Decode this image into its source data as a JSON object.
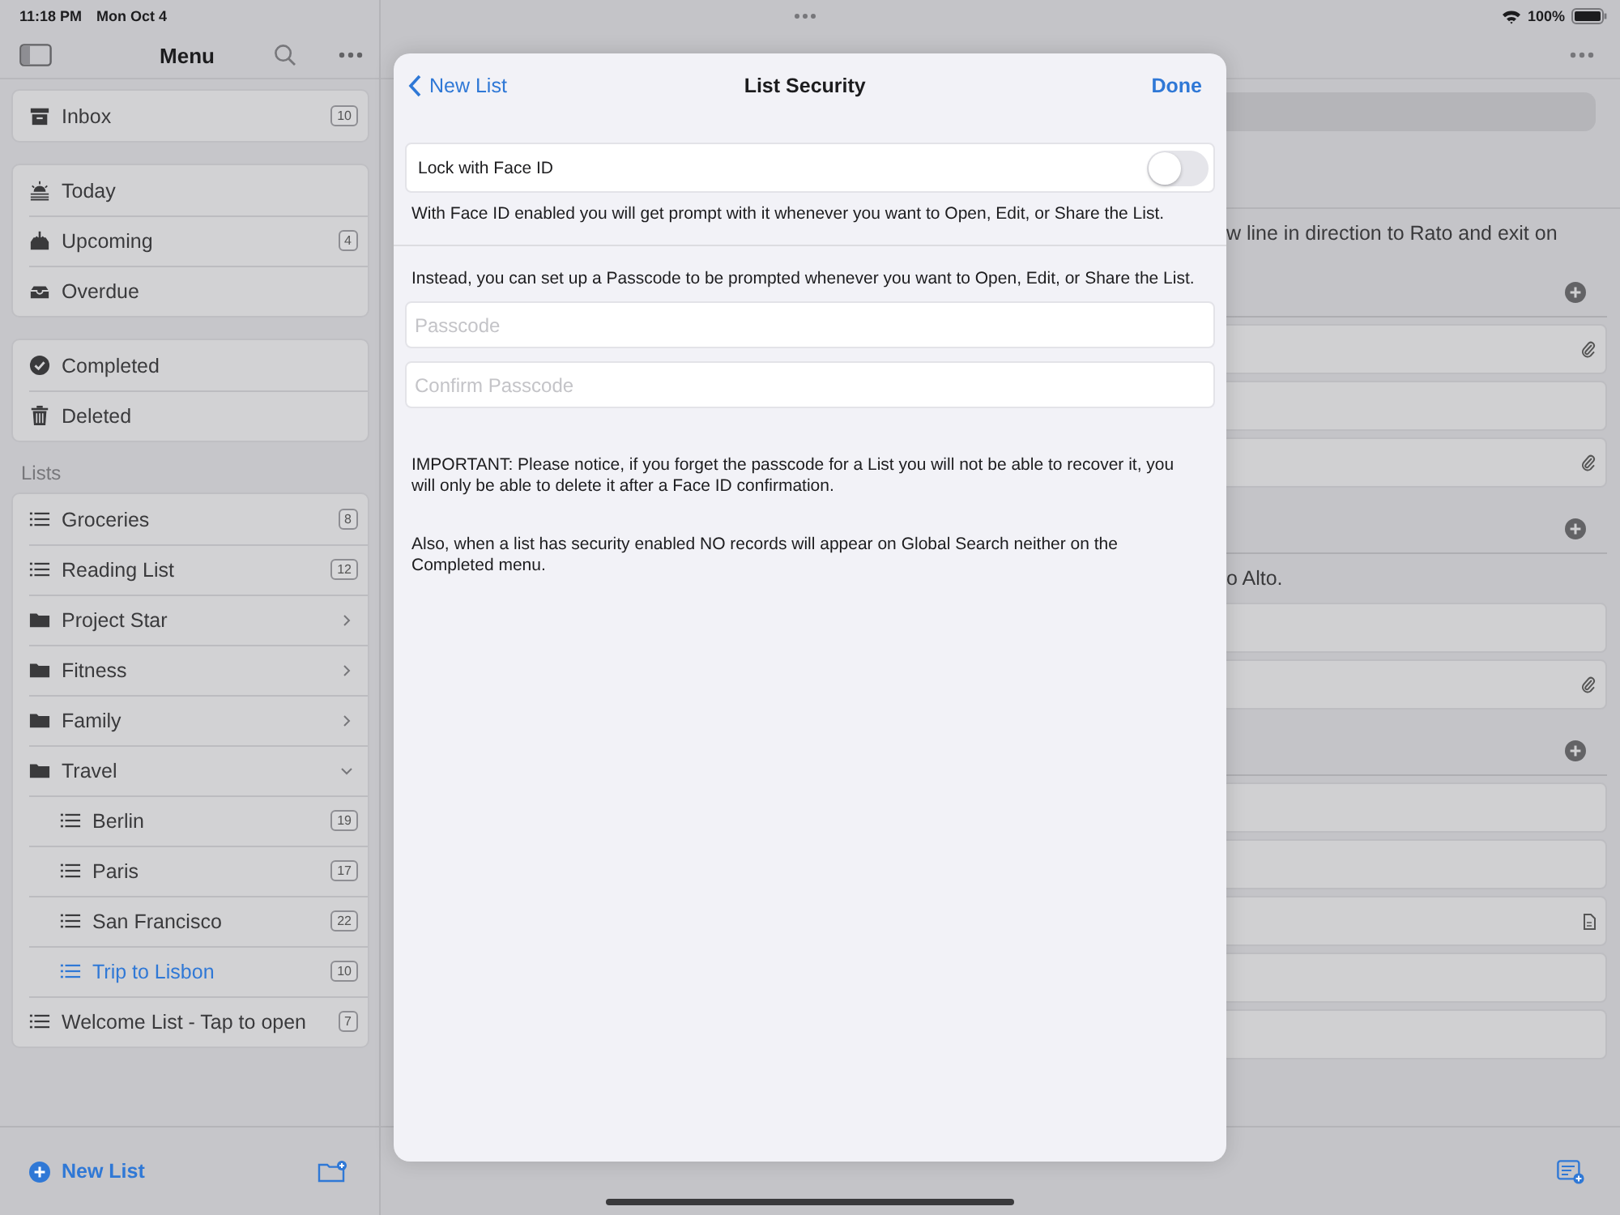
{
  "status_bar": {
    "time": "11:18 PM",
    "date": "Mon Oct 4",
    "battery": "100%"
  },
  "sidebar": {
    "title": "Menu",
    "groups": [
      [
        {
          "label": "Inbox",
          "kind": "inbox",
          "badge": "10"
        }
      ],
      [
        {
          "label": "Today",
          "kind": "today"
        },
        {
          "label": "Upcoming",
          "kind": "upcoming",
          "badge": "4"
        },
        {
          "label": "Overdue",
          "kind": "overdue"
        }
      ],
      [
        {
          "label": "Completed",
          "kind": "completed"
        },
        {
          "label": "Deleted",
          "kind": "deleted"
        }
      ]
    ],
    "lists_heading": "Lists",
    "lists": [
      {
        "label": "Groceries",
        "kind": "list",
        "badge": "8",
        "selected": false
      },
      {
        "label": "Reading List",
        "kind": "list",
        "badge": "12",
        "selected": false
      },
      {
        "label": "Project Star",
        "kind": "folder",
        "expanded": false,
        "selected": false
      },
      {
        "label": "Fitness",
        "kind": "folder",
        "expanded": false,
        "selected": false
      },
      {
        "label": "Family",
        "kind": "folder",
        "expanded": false,
        "selected": false
      },
      {
        "label": "Travel",
        "kind": "folder",
        "expanded": true,
        "selected": false,
        "children": [
          {
            "label": "Berlin",
            "kind": "list",
            "badge": "19",
            "selected": false
          },
          {
            "label": "Paris",
            "kind": "list",
            "badge": "17",
            "selected": false
          },
          {
            "label": "San Francisco",
            "kind": "list",
            "badge": "22",
            "selected": false
          },
          {
            "label": "Trip to Lisbon",
            "kind": "list",
            "badge": "10",
            "selected": true
          }
        ]
      },
      {
        "label": "Welcome List - Tap to open",
        "kind": "list",
        "badge": "7",
        "selected": false
      }
    ],
    "new_list": "New List"
  },
  "detail": {
    "note": "w line in direction to Rato and exit on",
    "sections": [
      {
        "records": [
          {
            "kind": "attachment"
          },
          {
            "kind": "plain"
          },
          {
            "kind": "attachment"
          }
        ]
      },
      {
        "note": "o Alto.",
        "records": [
          {
            "kind": "plain"
          },
          {
            "kind": "attachment"
          }
        ]
      },
      {
        "records": [
          {
            "kind": "plain"
          },
          {
            "kind": "plain"
          },
          {
            "kind": "document"
          },
          {
            "kind": "plain"
          },
          {
            "kind": "plain"
          }
        ]
      }
    ]
  },
  "dialog": {
    "back": "New List",
    "title": "List Security",
    "done": "Done",
    "face_id": {
      "label": "Lock with Face ID",
      "on": false
    },
    "face_id_note": "With Face ID enabled you will get prompt with it whenever you want to Open, Edit, or Share the List.",
    "passcode_note": "Instead, you can set up a Passcode to be prompted whenever you want to Open, Edit, or Share the List.",
    "fields": [
      {
        "placeholder": "Passcode"
      },
      {
        "placeholder": "Confirm Passcode"
      }
    ],
    "notes": [
      "IMPORTANT: Please notice, if you forget the passcode for a List you will not be able to recover it, you will only be able to delete it after a Face ID confirmation.",
      "Also, when a list has security enabled NO records will appear on Global Search neither on the Completed menu."
    ]
  }
}
